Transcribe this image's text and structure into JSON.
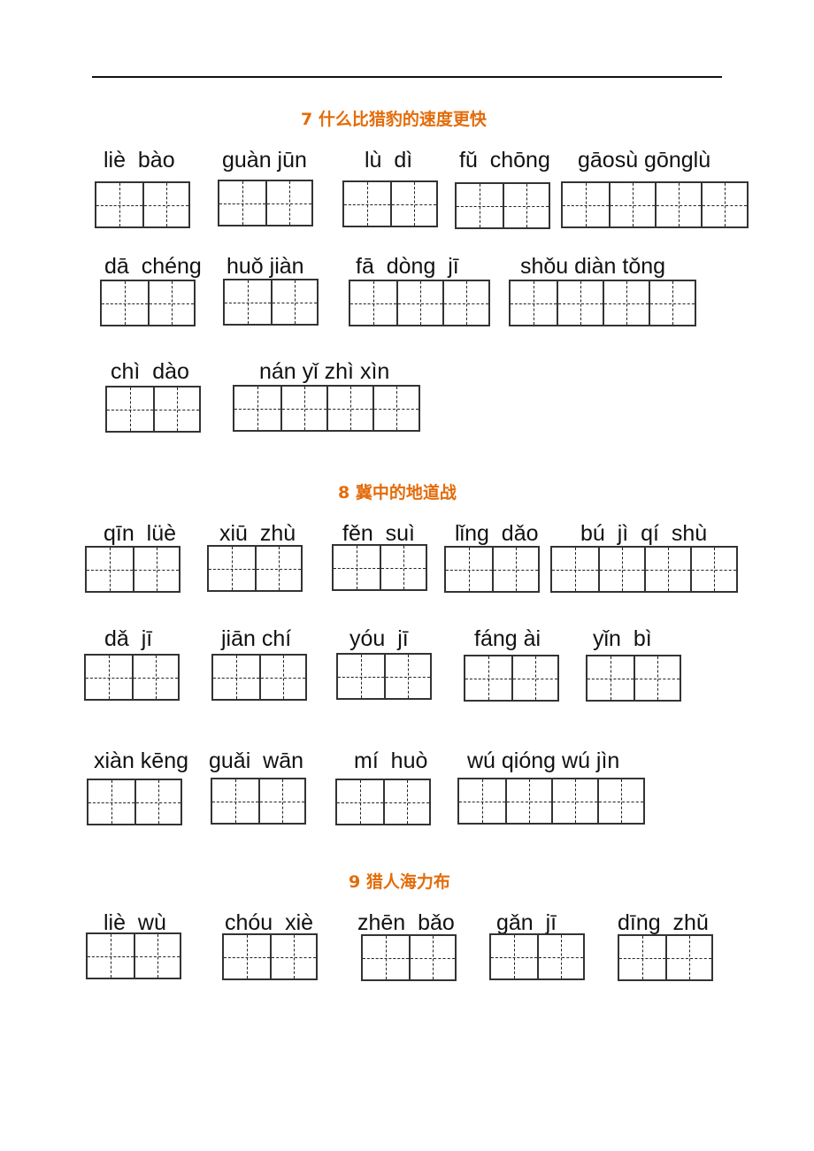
{
  "sections": [
    {
      "title": "7  什么比猎豹的速度更快",
      "words": [
        {
          "pinyin": "liè  bào",
          "chars": 2
        },
        {
          "pinyin": "guàn jūn",
          "chars": 2
        },
        {
          "pinyin": "lù  dì",
          "chars": 2
        },
        {
          "pinyin": "fǔ  chōng",
          "chars": 2
        },
        {
          "pinyin": "gāosù gōnglù",
          "chars": 4
        },
        {
          "pinyin": "dā  chéng",
          "chars": 2
        },
        {
          "pinyin": "huǒ jiàn",
          "chars": 2
        },
        {
          "pinyin": "fā  dòng  jī",
          "chars": 3
        },
        {
          "pinyin": "shǒu diàn tǒng",
          "chars": 4
        },
        {
          "pinyin": "chì  dào",
          "chars": 2
        },
        {
          "pinyin": "nán yǐ zhì xìn",
          "chars": 4
        }
      ]
    },
    {
      "title": "8  冀中的地道战",
      "words": [
        {
          "pinyin": "qīn  lüè",
          "chars": 2
        },
        {
          "pinyin": "xiū  zhù",
          "chars": 2
        },
        {
          "pinyin": "fěn  suì",
          "chars": 2
        },
        {
          "pinyin": "lǐng  dǎo",
          "chars": 2
        },
        {
          "pinyin": "bú  jì  qí  shù",
          "chars": 4
        },
        {
          "pinyin": "dǎ  jī",
          "chars": 2
        },
        {
          "pinyin": "jiān chí",
          "chars": 2
        },
        {
          "pinyin": "yóu  jī",
          "chars": 2
        },
        {
          "pinyin": "fáng ài",
          "chars": 2
        },
        {
          "pinyin": "yǐn  bì",
          "chars": 2
        },
        {
          "pinyin": "xiàn kēng",
          "chars": 2
        },
        {
          "pinyin": "guǎi  wān",
          "chars": 2
        },
        {
          "pinyin": "mí  huò",
          "chars": 2
        },
        {
          "pinyin": "wú qióng wú jìn",
          "chars": 4
        }
      ]
    },
    {
      "title": "9  猎人海力布",
      "words": [
        {
          "pinyin": "liè  wù",
          "chars": 2
        },
        {
          "pinyin": "chóu  xiè",
          "chars": 2
        },
        {
          "pinyin": "zhēn  bǎo",
          "chars": 2
        },
        {
          "pinyin": "gǎn  jī",
          "chars": 2
        },
        {
          "pinyin": "dīng  zhǔ",
          "chars": 2
        }
      ]
    }
  ]
}
